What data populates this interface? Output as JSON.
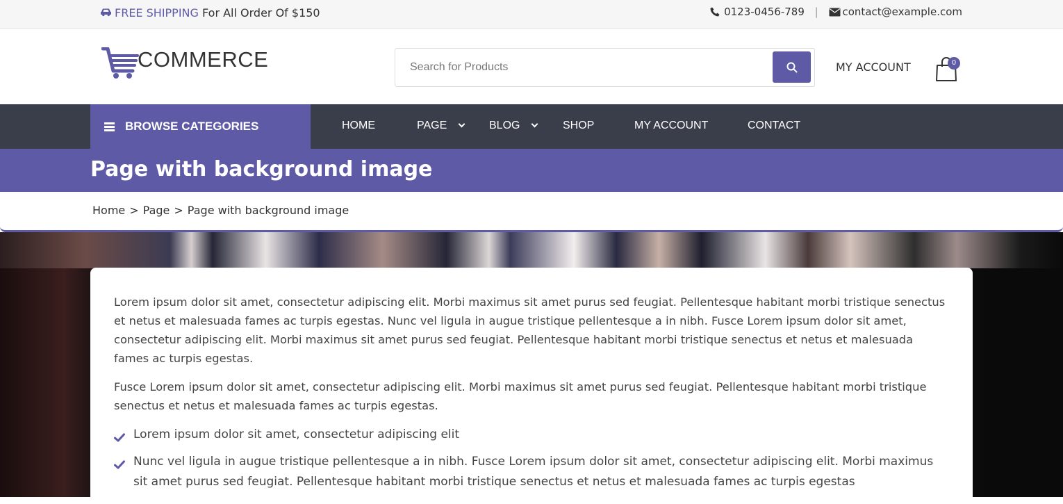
{
  "topbar": {
    "shipping_accent": "FREE SHIPPING",
    "shipping_text": "For All Order Of $150",
    "phone": "0123-0456-789",
    "separator": "|",
    "email": "contact@example.com"
  },
  "header": {
    "logo_text": "COMMERCE",
    "search_placeholder": "Search for Products",
    "my_account": "MY ACCOUNT",
    "cart_count": "0"
  },
  "nav": {
    "browse_label": "BROWSE CATEGORIES",
    "items": [
      {
        "label": "HOME"
      },
      {
        "label": "PAGE"
      },
      {
        "label": "BLOG"
      },
      {
        "label": "SHOP"
      },
      {
        "label": "MY ACCOUNT"
      },
      {
        "label": "CONTACT"
      }
    ]
  },
  "page": {
    "title": "Page with background image",
    "breadcrumb": [
      "Home",
      "Page",
      "Page with background image"
    ],
    "breadcrumb_sep": ">"
  },
  "content": {
    "paragraphs": [
      "Lorem ipsum dolor sit amet, consectetur adipiscing elit. Morbi maximus sit amet purus sed feugiat. Pellentesque habitant morbi tristique senectus et netus et malesuada fames ac turpis egestas. Nunc vel ligula in augue tristique pellentesque a in nibh. Fusce Lorem ipsum dolor sit amet, consectetur adipiscing elit. Morbi maximus sit amet purus sed feugiat. Pellentesque habitant morbi tristique senectus et netus et malesuada fames ac turpis egestas.",
      "Fusce Lorem ipsum dolor sit amet, consectetur adipiscing elit. Morbi maximus sit amet purus sed feugiat. Pellentesque habitant morbi tristique senectus et netus et malesuada fames ac turpis egestas."
    ],
    "list": [
      "Lorem ipsum dolor sit amet, consectetur adipiscing elit",
      "Nunc vel ligula in augue tristique pellentesque a in nibh. Fusce Lorem ipsum dolor sit amet, consectetur adipiscing elit. Morbi maximus sit amet purus sed feugiat. Pellentesque habitant morbi tristique senectus et netus et malesuada fames ac turpis egestas"
    ]
  },
  "colors": {
    "accent": "#5f5aa6",
    "nav_bg": "#3a3d4a",
    "topbar_bg": "#f7f6f6"
  },
  "icons": {
    "shipping": "truck-icon",
    "phone": "phone-icon",
    "email": "envelope-icon",
    "search": "search-icon",
    "cart": "shopping-bag-icon",
    "menu": "hamburger-icon",
    "dropdown": "chevron-down-icon",
    "list_bullet": "check-icon"
  }
}
